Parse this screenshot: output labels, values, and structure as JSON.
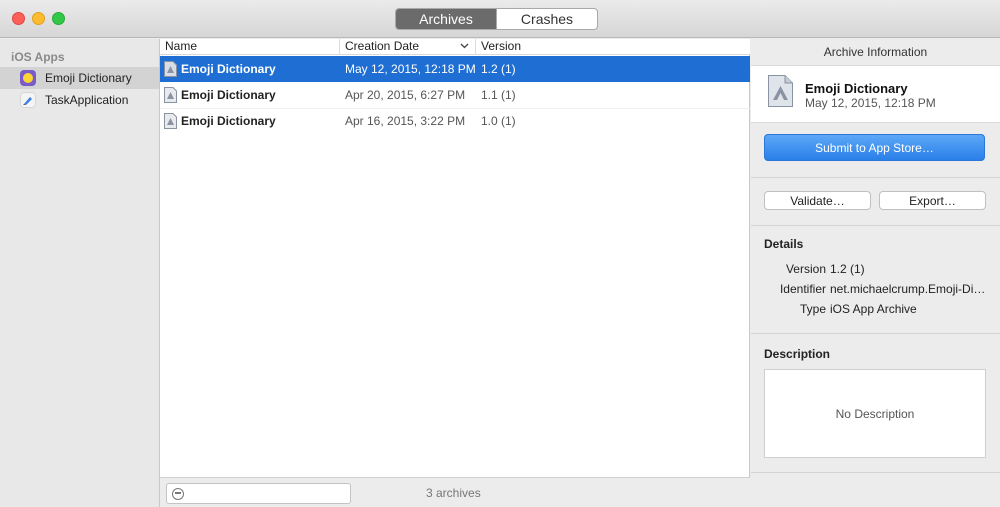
{
  "toolbar": {
    "segments": [
      "Archives",
      "Crashes"
    ],
    "active_segment": "Archives"
  },
  "sidebar": {
    "header": "iOS Apps",
    "items": [
      {
        "label": "Emoji Dictionary",
        "icon": "emoji-app-icon",
        "selected": true
      },
      {
        "label": "TaskApplication",
        "icon": "task-app-icon",
        "selected": false
      }
    ]
  },
  "table": {
    "columns": [
      "Name",
      "Creation Date",
      "Version"
    ],
    "rows": [
      {
        "name": "Emoji Dictionary",
        "date": "May 12, 2015, 12:18 PM",
        "version": "1.2 (1)",
        "selected": true
      },
      {
        "name": "Emoji Dictionary",
        "date": "Apr 20, 2015, 6:27 PM",
        "version": "1.1 (1)",
        "selected": false
      },
      {
        "name": "Emoji Dictionary",
        "date": "Apr 16, 2015, 3:22 PM",
        "version": "1.0 (1)",
        "selected": false
      }
    ]
  },
  "footer": {
    "search_value": "",
    "count": "3 archives"
  },
  "info": {
    "title": "Archive Information",
    "archive_name": "Emoji Dictionary",
    "archive_date": "May 12, 2015, 12:18 PM",
    "submit_label": "Submit to App Store…",
    "validate_label": "Validate…",
    "export_label": "Export…",
    "details_header": "Details",
    "details": [
      {
        "key": "Version",
        "value": "1.2 (1)"
      },
      {
        "key": "Identifier",
        "value": "net.michaelcrump.Emoji-Di…"
      },
      {
        "key": "Type",
        "value": "iOS App Archive"
      }
    ],
    "description_header": "Description",
    "description": "No Description"
  },
  "colors": {
    "selection": "#1f6ed3",
    "primary_button": "#2a7fe8"
  }
}
